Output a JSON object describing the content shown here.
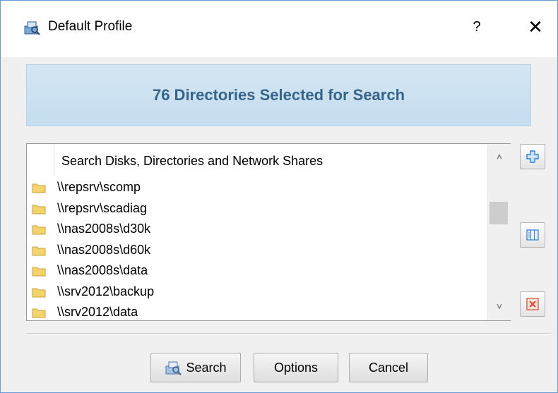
{
  "window": {
    "title": "Default Profile",
    "help_label": "?",
    "close_label": "✕"
  },
  "banner": {
    "text": "76 Directories Selected for Search"
  },
  "list": {
    "header": "Search Disks, Directories and Network Shares",
    "items": [
      {
        "label": "\\\\repsrv\\scomp",
        "icon": "folder-icon"
      },
      {
        "label": "\\\\repsrv\\scadiag",
        "icon": "folder-icon"
      },
      {
        "label": "\\\\nas2008s\\d30k",
        "icon": "folder-icon"
      },
      {
        "label": "\\\\nas2008s\\d60k",
        "icon": "folder-icon"
      },
      {
        "label": "\\\\nas2008s\\data",
        "icon": "folder-icon"
      },
      {
        "label": "\\\\srv2012\\backup",
        "icon": "folder-icon"
      },
      {
        "label": "\\\\srv2012\\data",
        "icon": "folder-icon"
      }
    ],
    "scroll_up": "˄",
    "scroll_down": "˅"
  },
  "side_buttons": [
    {
      "icon": "add-icon"
    },
    {
      "icon": "edit-list-icon"
    },
    {
      "icon": "delete-icon"
    }
  ],
  "buttons": {
    "search": "Search",
    "options": "Options",
    "cancel": "Cancel"
  },
  "colors": {
    "banner_text": "#36648b",
    "banner_bg": "#cfe3f2",
    "folder": "#f5d36b",
    "accent": "#2f7fd4",
    "delete": "#d9482c"
  }
}
